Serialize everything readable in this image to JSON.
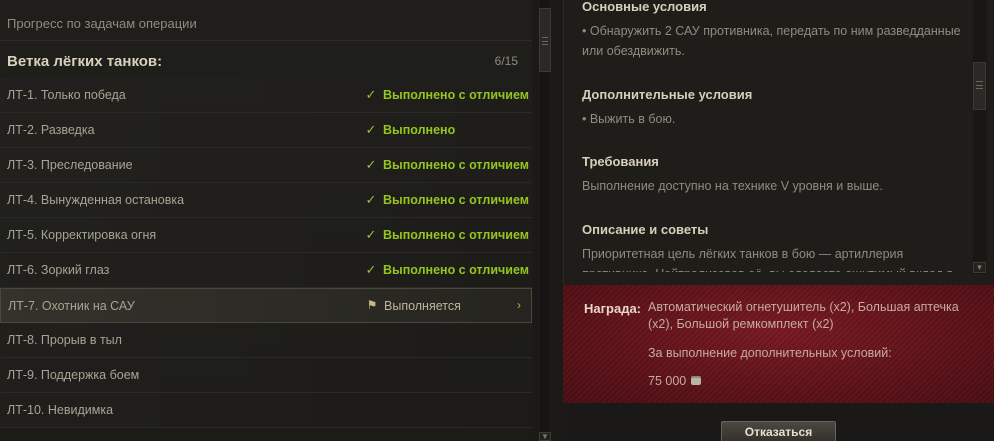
{
  "progress_header": "Прогресс по задачам операции",
  "branch": {
    "title": "Ветка лёгких танков:",
    "count": "6/15"
  },
  "tasks": [
    {
      "name": "ЛТ-1. Только победа",
      "status": "Выполнено с отличием",
      "state": "done"
    },
    {
      "name": "ЛТ-2. Разведка",
      "status": "Выполнено",
      "state": "done"
    },
    {
      "name": "ЛТ-3. Преследование",
      "status": "Выполнено с отличием",
      "state": "done"
    },
    {
      "name": "ЛТ-4. Вынужденная остановка",
      "status": "Выполнено с отличием",
      "state": "done"
    },
    {
      "name": "ЛТ-5. Корректировка огня",
      "status": "Выполнено с отличием",
      "state": "done"
    },
    {
      "name": "ЛТ-6. Зоркий глаз",
      "status": "Выполнено с отличием",
      "state": "done"
    },
    {
      "name": "ЛТ-7. Охотник на САУ",
      "status": "Выполняется",
      "state": "in-progress"
    },
    {
      "name": "ЛТ-8. Прорыв в тыл",
      "status": "",
      "state": "none"
    },
    {
      "name": "ЛТ-9. Поддержка боем",
      "status": "",
      "state": "none"
    },
    {
      "name": "ЛТ-10. Невидимка",
      "status": "",
      "state": "none"
    }
  ],
  "details": {
    "main_title": "Основные условия",
    "main_text": "• Обнаружить 2 САУ противника, передать по ним разведданные или обездвижить.",
    "extra_title": "Дополнительные условия",
    "extra_text": "• Выжить в бою.",
    "req_title": "Требования",
    "req_text": "Выполнение доступно на технике V уровня и выше.",
    "desc_title": "Описание и советы",
    "desc_text": "Приоритетная цель лёгких танков в бою — артиллерия противника. Нейтрализовав её, вы сделаете ощутимый вклад в победу вашей"
  },
  "reward": {
    "label": "Награда:",
    "items": "Автоматический огнетушитель (x2), Большая аптечка (x2), Большой ремкомплект (x2)",
    "extra_label": "За выполнение дополнительных условий:",
    "credits": "75 000"
  },
  "buttons": {
    "decline": "Отказаться"
  },
  "colors": {
    "done": "#95c51f",
    "reward_bg": "#5e1219"
  }
}
